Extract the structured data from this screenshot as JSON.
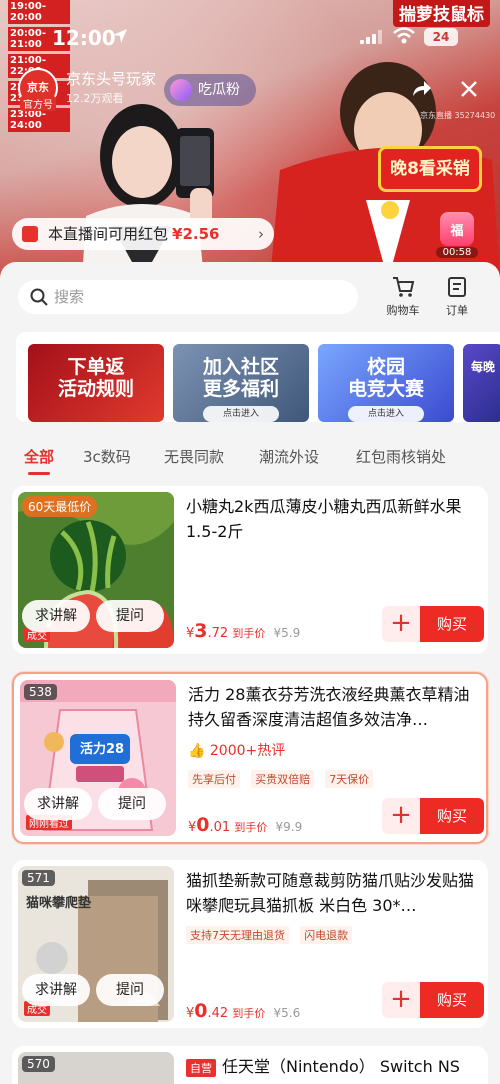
{
  "live": {
    "schedule": [
      "19:00-20:00",
      "20:00-21:00",
      "21:00-22:00",
      "22:00-23:00",
      "23:00-24:00"
    ],
    "top_right_banner": "揣萝技鼠标",
    "status_time": "12:00",
    "battery": "24",
    "host_name": "京东头号玩家",
    "official_label": "官方号",
    "avatar_text": "京东",
    "viewers": "12.2万观看",
    "follow_label": "吃瓜粉",
    "room_id": "京东直播 35274430",
    "promo_sign": "晚8看采销",
    "red_packet_text": "本直播间可用红包",
    "red_packet_amount": "¥2.56",
    "fu_bag_label": "福",
    "fu_bag_timer": "00:58"
  },
  "panel": {
    "search_placeholder": "搜索",
    "cart_label": "购物车",
    "order_label": "订单",
    "banners": [
      {
        "line1": "下单返",
        "line2": "活动规则",
        "enter": ""
      },
      {
        "line1": "加入社区",
        "line2": "更多福利",
        "enter": "点击进入"
      },
      {
        "line1": "校园",
        "line2": "电竞大赛",
        "enter": "点击进入"
      },
      {
        "line1": "每晚",
        "line2": "",
        "enter": ""
      }
    ],
    "tabs": [
      "全部",
      "3c数码",
      "无畏同款",
      "潮流外设",
      "红包雨核销处"
    ]
  },
  "products": [
    {
      "badge": "60天最低价",
      "number": "",
      "title": "小糖丸2k西瓜薄皮小糖丸西瓜新鲜水果 1.5-2斤",
      "hot": "",
      "tags": [],
      "price_int": "3",
      "price_dec": ".72",
      "price_label": "到手价",
      "orig_price": "¥5.9",
      "ask_label": "求讲解",
      "hint_label": "提问",
      "buy_label": "购买",
      "corner": "成交"
    },
    {
      "badge": "",
      "number": "538",
      "title": "活力 28薰衣芬芳洗衣液经典薰衣草精油持久留香深度清洁超值多效洁净…",
      "hot": "2000+热评",
      "tags": [
        "先享后付",
        "买贵双倍赔",
        "7天保价"
      ],
      "price_int": "0",
      "price_dec": ".01",
      "price_label": "到手价",
      "orig_price": "¥9.9",
      "ask_label": "求讲解",
      "hint_label": "提问",
      "buy_label": "购买",
      "corner": "刚刚看过",
      "pack_brand": "活力28"
    },
    {
      "badge": "",
      "number": "571",
      "title": "猫抓垫新款可随意裁剪防猫爪贴沙发贴猫咪攀爬玩具猫抓板 米白色 30*…",
      "hot": "",
      "tags": [
        "支持7天无理由退货",
        "闪电退款"
      ],
      "price_int": "0",
      "price_dec": ".42",
      "price_label": "到手价",
      "orig_price": "¥5.6",
      "ask_label": "求讲解",
      "hint_label": "提问",
      "buy_label": "购买",
      "corner": "成交",
      "thumb_text": "猫咪攀爬垫"
    },
    {
      "badge": "",
      "number": "570",
      "title": "任天堂（Nintendo） Switch NS",
      "tag_prefix": "自营"
    }
  ]
}
